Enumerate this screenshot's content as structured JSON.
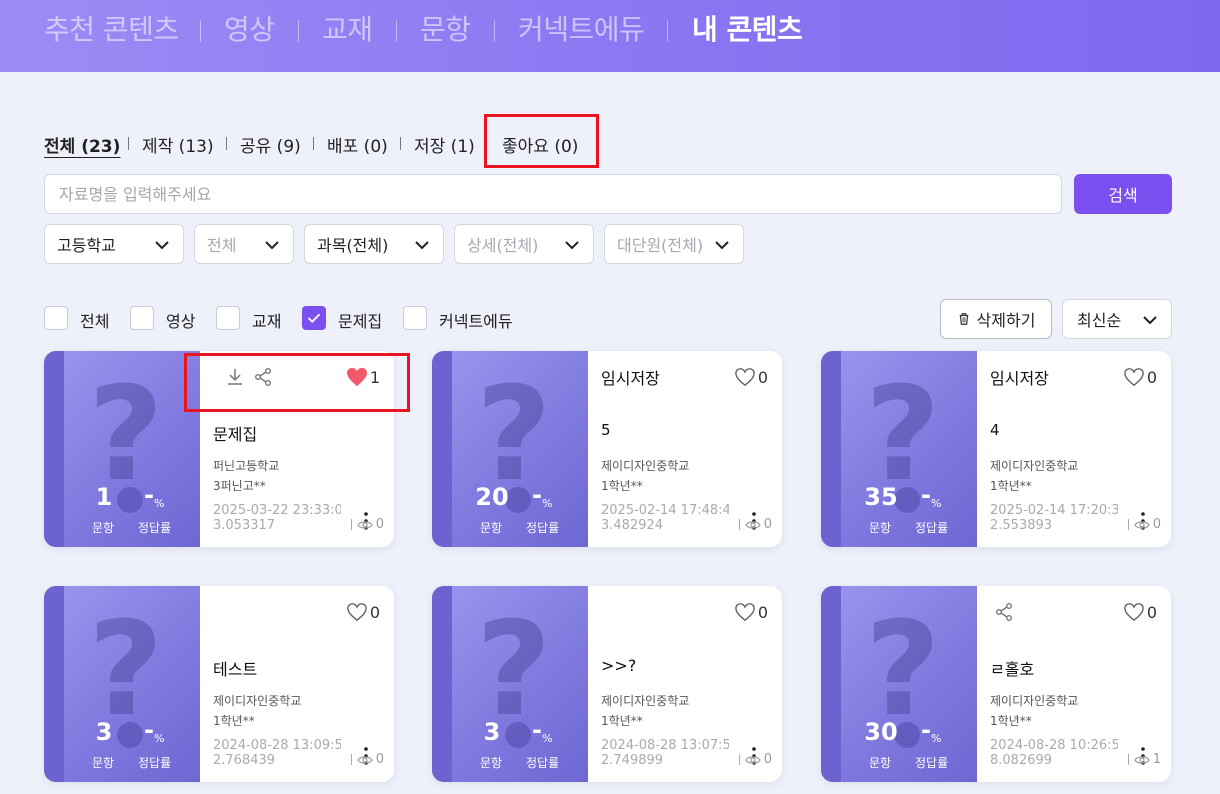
{
  "nav": {
    "items": [
      "추천 콘텐츠",
      "영상",
      "교재",
      "문항",
      "커넥트에듀",
      "내 콘텐츠"
    ],
    "active": "내 콘텐츠"
  },
  "subtabs": [
    "전체 (23)",
    "제작 (13)",
    "공유 (9)",
    "배포 (0)",
    "저장 (1)",
    "좋아요 (0)"
  ],
  "search": {
    "placeholder": "자료명을 입력해주세요",
    "button": "검색"
  },
  "filters": [
    "고등학교",
    "전체",
    "과목(전체)",
    "상세(전체)",
    "대단원(전체)"
  ],
  "types": [
    {
      "label": "전체",
      "checked": false
    },
    {
      "label": "영상",
      "checked": false
    },
    {
      "label": "교재",
      "checked": false
    },
    {
      "label": "문제집",
      "checked": true
    },
    {
      "label": "커넥트에듀",
      "checked": false
    }
  ],
  "actions": {
    "delete": "삭제하기",
    "sort": "최신순"
  },
  "card_labels": {
    "count_label": "문항",
    "rate_label": "정답률",
    "rate_value": "-",
    "pct": "%"
  },
  "cards": [
    {
      "count": "1",
      "title": "문제집",
      "sub": "",
      "school": "퍼닌고등학교",
      "grade": "3퍼닌고**",
      "date": "2025-03-22 23:33:0",
      "date2": "3.053317",
      "likes": "1",
      "liked": true,
      "views": "0",
      "download": true,
      "share": true
    },
    {
      "count": "20",
      "title": "임시저장",
      "sub": "5",
      "school": "제이디자인중학교",
      "grade": "1학년**",
      "date": "2025-02-14 17:48:4",
      "date2": "3.482924",
      "likes": "0",
      "liked": false,
      "views": "0",
      "download": false,
      "share": false
    },
    {
      "count": "35",
      "title": "임시저장",
      "sub": "4",
      "school": "제이디자인중학교",
      "grade": "1학년**",
      "date": "2025-02-14 17:20:3",
      "date2": "2.553893",
      "likes": "0",
      "liked": false,
      "views": "0",
      "download": false,
      "share": false
    },
    {
      "count": "3",
      "title": "테스트",
      "sub": "",
      "school": "제이디자인중학교",
      "grade": "1학년**",
      "date": "2024-08-28 13:09:5",
      "date2": "2.768439",
      "likes": "0",
      "liked": false,
      "views": "0",
      "download": false,
      "share": false
    },
    {
      "count": "3",
      "title": ">>?",
      "sub": "",
      "school": "제이디자인중학교",
      "grade": "1학년**",
      "date": "2024-08-28 13:07:5",
      "date2": "2.749899",
      "likes": "0",
      "liked": false,
      "views": "0",
      "download": false,
      "share": false
    },
    {
      "count": "30",
      "title": "ㄹ홀호",
      "sub": "",
      "school": "제이디자인중학교",
      "grade": "1학년**",
      "date": "2024-08-28 10:26:5",
      "date2": "8.082699",
      "likes": "0",
      "liked": false,
      "views": "1",
      "download": false,
      "share": true
    }
  ],
  "colors": {
    "accent": "#7b4ff0",
    "highlight": "#e8141f",
    "heart": "#f05a6a"
  }
}
